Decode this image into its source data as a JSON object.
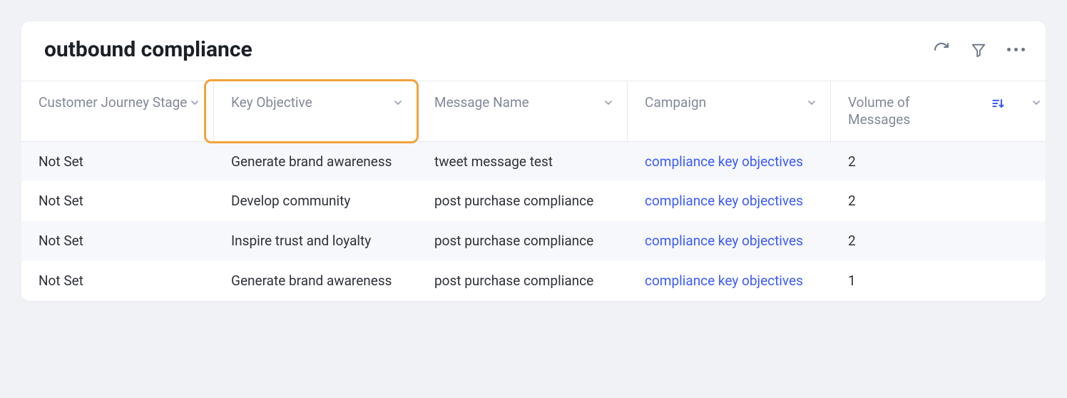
{
  "header": {
    "title": "outbound compliance"
  },
  "columns": [
    {
      "label": "Customer Journey Stage"
    },
    {
      "label": "Key Objective"
    },
    {
      "label": "Message Name"
    },
    {
      "label": "Campaign"
    },
    {
      "label": "Volume of Messages"
    }
  ],
  "rows": [
    {
      "stage": "Not Set",
      "objective": "Generate brand awareness",
      "message": "tweet message test",
      "campaign": "compliance key objectives",
      "volume": "2"
    },
    {
      "stage": "Not Set",
      "objective": "Develop community",
      "message": "post purchase compliance",
      "campaign": "compliance key objectives",
      "volume": "2"
    },
    {
      "stage": "Not Set",
      "objective": "Inspire trust and loyalty",
      "message": "post purchase compliance",
      "campaign": "compliance key objectives",
      "volume": "2"
    },
    {
      "stage": "Not Set",
      "objective": "Generate brand awareness",
      "message": "post purchase compliance",
      "campaign": "compliance key objectives",
      "volume": "1"
    }
  ]
}
